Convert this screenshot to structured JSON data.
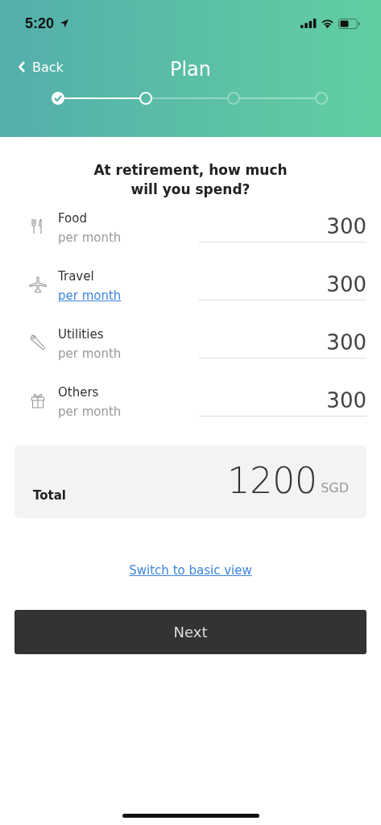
{
  "status_bar": {
    "time": "5:20"
  },
  "nav": {
    "back": "Back",
    "title": "Plan"
  },
  "steps": [
    {
      "kind": "done"
    },
    {
      "kind": "current"
    },
    {
      "kind": "todo"
    },
    {
      "kind": "todo"
    }
  ],
  "question": "At retirement, how much will you spend?",
  "expenses": [
    {
      "kind": "food",
      "label": "Food",
      "unit": "per month",
      "unit_link": false,
      "value": "300"
    },
    {
      "kind": "travel",
      "label": "Travel",
      "unit": "per month",
      "unit_link": true,
      "value": "300"
    },
    {
      "kind": "utilities",
      "label": "Utilities",
      "unit": "per month",
      "unit_link": false,
      "value": "300"
    },
    {
      "kind": "others",
      "label": "Others",
      "unit": "per month",
      "unit_link": false,
      "value": "300"
    }
  ],
  "total": {
    "label": "Total",
    "amount": "1200",
    "currency": "SGD"
  },
  "switch_link": "Switch to basic view",
  "next_button": "Next"
}
